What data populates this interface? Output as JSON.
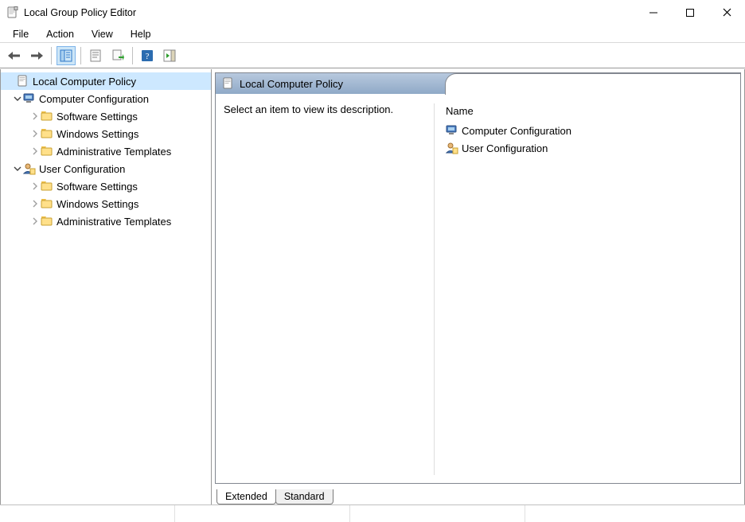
{
  "window_title": "Local Group Policy Editor",
  "menu": {
    "items": [
      "File",
      "Action",
      "View",
      "Help"
    ]
  },
  "tree": {
    "root_label": "Local Computer Policy",
    "nodes": [
      {
        "label": "Computer Configuration",
        "children": [
          "Software Settings",
          "Windows Settings",
          "Administrative Templates"
        ]
      },
      {
        "label": "User Configuration",
        "children": [
          "Software Settings",
          "Windows Settings",
          "Administrative Templates"
        ]
      }
    ]
  },
  "right": {
    "header_title": "Local Computer Policy",
    "desc_text": "Select an item to view its description.",
    "column_name": "Name",
    "items": [
      "Computer Configuration",
      "User Configuration"
    ]
  },
  "tabs": {
    "extended": "Extended",
    "standard": "Standard"
  }
}
